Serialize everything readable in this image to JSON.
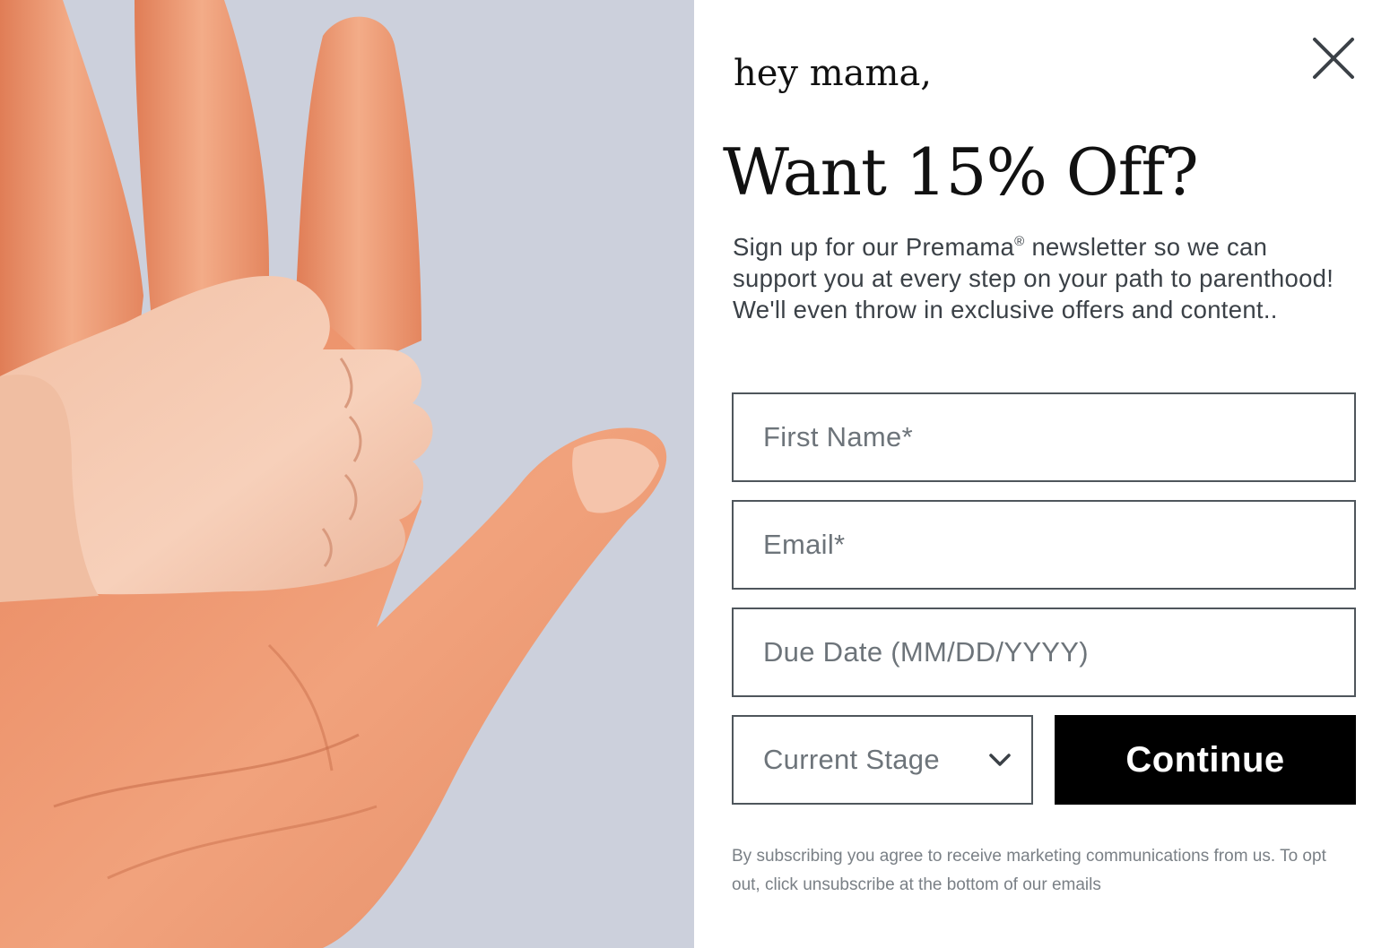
{
  "popup": {
    "greeting": "hey mama,",
    "headline": "Want 15% Off?",
    "intro_before_mark": "Sign up for our Premama",
    "intro_mark": "®",
    "intro_after_mark": " newsletter so we can support you at every step on your path to parenthood! We'll even throw in exclusive offers and content..",
    "close_icon": "close-x-icon",
    "image_alt": "adult hand holding baby hand"
  },
  "form": {
    "first_name_placeholder": "First Name*",
    "first_name_value": "",
    "email_placeholder": "Email*",
    "email_value": "",
    "due_date_placeholder": "Due Date (MM/DD/YYYY)",
    "due_date_value": "",
    "stage_label": "Current Stage",
    "stage_icon": "chevron-down-icon",
    "continue_label": "Continue"
  },
  "disclaimer": "By subscribing you agree to receive marketing communications from us. To opt out, click unsubscribe at the bottom of our emails",
  "colors": {
    "photo_background": "#ccd0dc",
    "button_background": "#000000",
    "button_text": "#ffffff",
    "field_border": "#4f565c",
    "body_text": "#3b4147",
    "placeholder_text": "#6d747a",
    "heading_text": "#111111",
    "disclaimer_text": "#7a8086"
  }
}
